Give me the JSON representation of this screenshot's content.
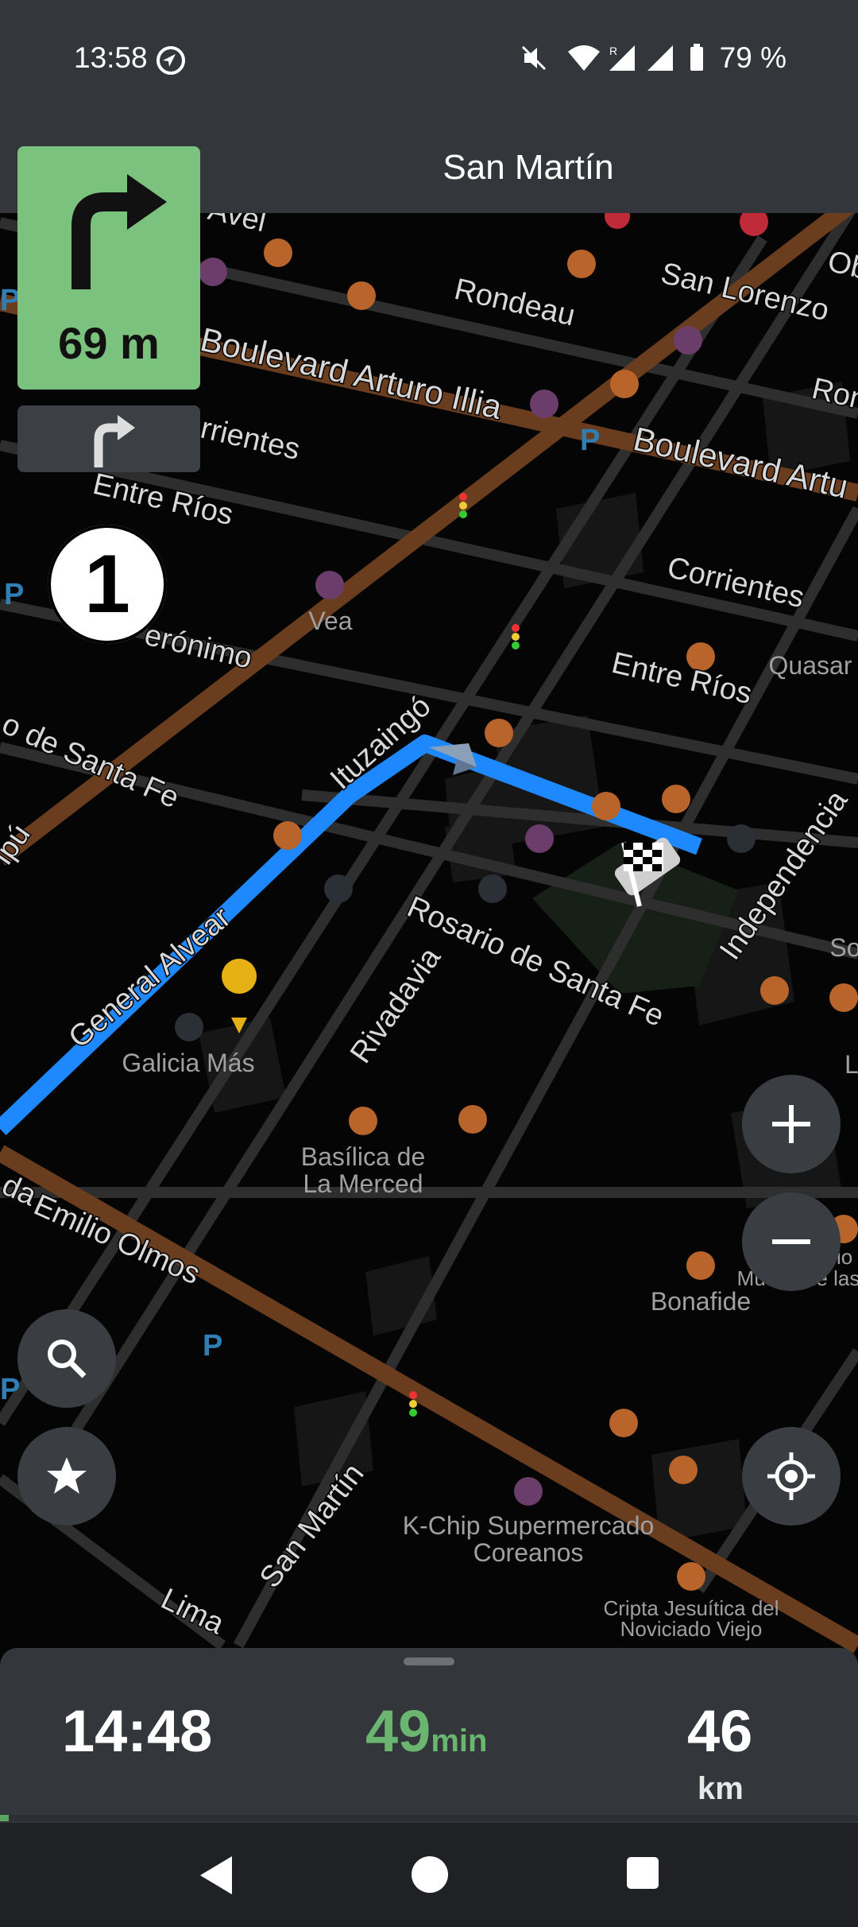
{
  "status_bar": {
    "time": "13:58",
    "battery_text": "79 %",
    "icons": [
      "navigation-arrow-icon",
      "mute-icon",
      "wifi-icon",
      "signal-roaming-icon",
      "signal-icon",
      "battery-icon"
    ]
  },
  "navigation": {
    "street_name": "San Martín",
    "turn_distance": "69 m",
    "turn_direction_icon": "turn-right-icon",
    "next_turn_icon": "turn-right-icon",
    "roundabout_exit": "1"
  },
  "map": {
    "street_labels": [
      "Rondeau",
      "San Lorenzo",
      "Boulevard Arturo Illia",
      "Boulevard Artu",
      "Corrientes",
      "Entre Ríos",
      "Ituzaingó",
      "General Alvear",
      "Rosario de Santa Fe",
      "Rivadavia",
      "Independencia",
      "Emilio Olmos",
      "San Martín",
      "Lima",
      "Ob",
      "Rond",
      "Avel",
      "orrientes",
      "Entre Ríos",
      "erónimo",
      "o de Santa Fe",
      "ipú",
      "da",
      "Corrientes"
    ],
    "place_labels": [
      "Vea",
      "Quasar",
      "Galicia Más",
      "Basílica de",
      "La Merced",
      "Bonafide",
      "Espacio C",
      "Museo de las",
      "K-Chip Supermercado",
      "Coreanos",
      "Cripta Jesuítica del",
      "Noviciado Viejo",
      "So",
      "L"
    ],
    "colors": {
      "route": "#1e88ff",
      "avenue": "#6b3d1f",
      "street": "#3a3a3a",
      "poi_orange": "#b8642a",
      "poi_purple": "#6b3d6b",
      "turn_panel": "#7bc27f"
    }
  },
  "controls": {
    "zoom_in_icon": "plus-icon",
    "zoom_out_icon": "minus-icon",
    "search_icon": "search-icon",
    "favorites_icon": "star-icon",
    "locate_icon": "crosshair-icon"
  },
  "trip": {
    "eta": "14:48",
    "duration": "49",
    "duration_unit": "min",
    "distance": "46",
    "distance_unit": "km",
    "progress": 0.01
  },
  "system_nav": {
    "icons": [
      "back-icon",
      "home-icon",
      "recents-icon"
    ]
  }
}
